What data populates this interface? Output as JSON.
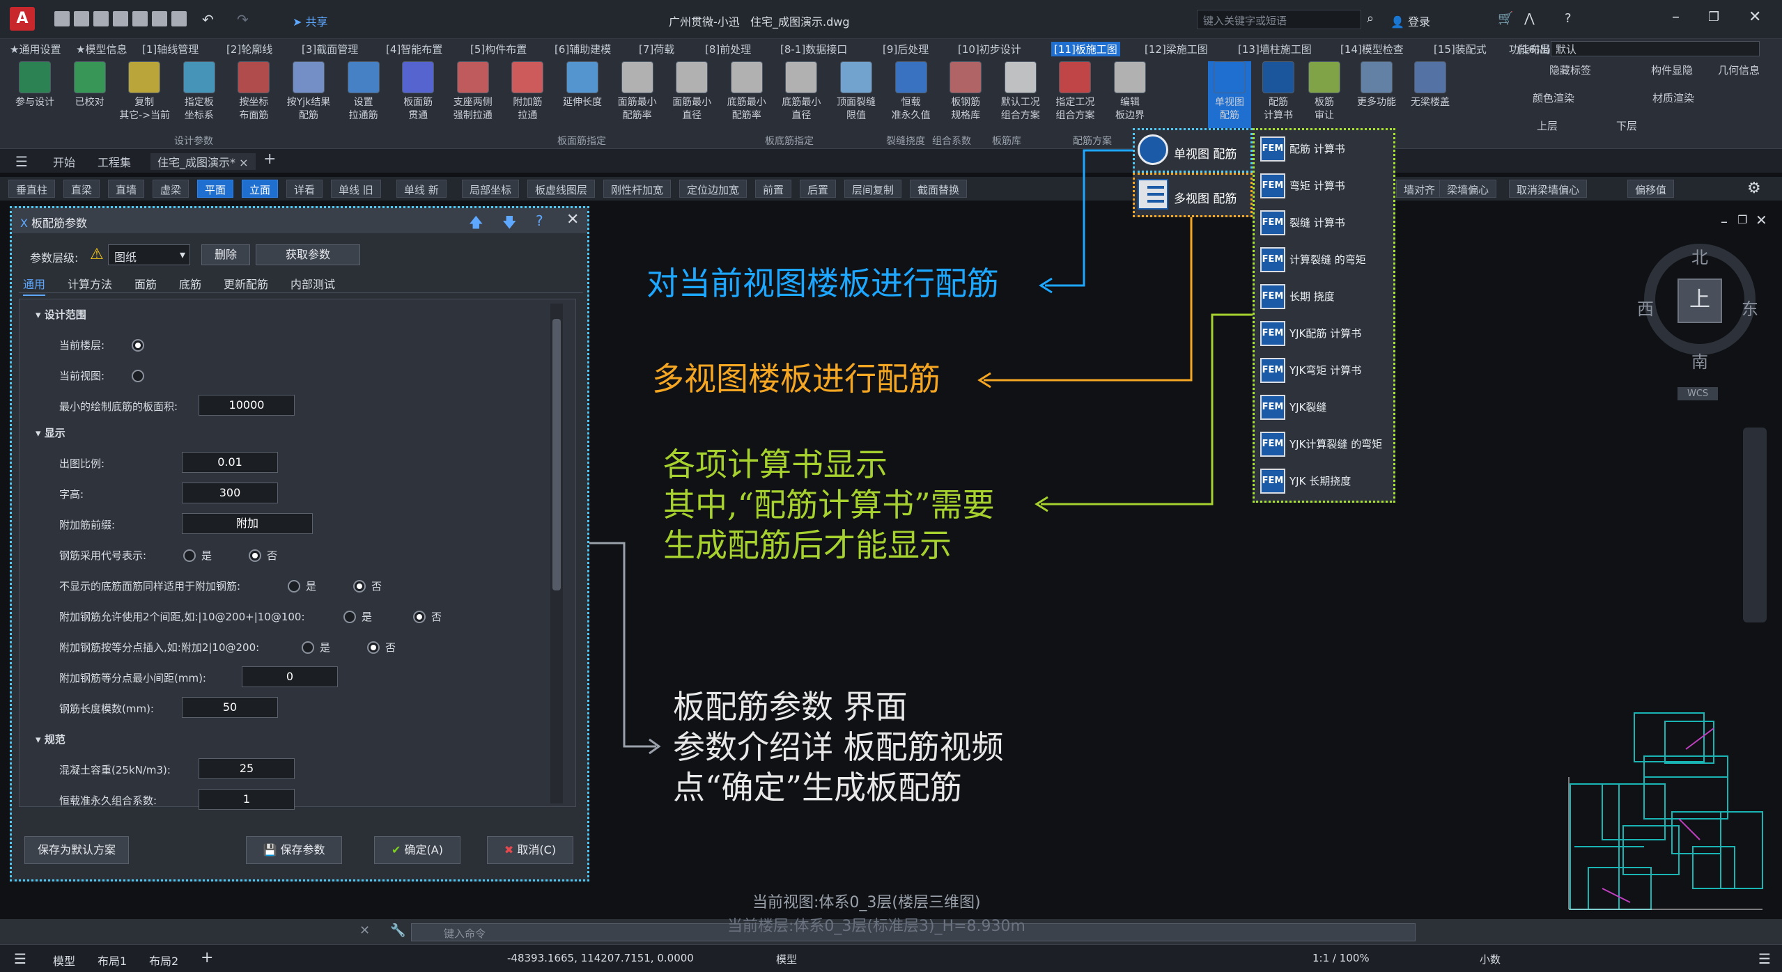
{
  "titlebar": {
    "share": "共享",
    "app_title": "广州贯微-小迅",
    "doc_title": "住宅_成图演示.dwg",
    "search_placeholder": "键入关键字或短语",
    "login": "登录"
  },
  "menu": {
    "items": [
      "★通用设置",
      "★模型信息",
      "[1]轴线管理",
      "[2]轮廓线",
      "[3]截面管理",
      "[4]智能布置",
      "[5]构件布置",
      "[6]辅助建模",
      "[7]荷载",
      "[8]前处理",
      "[8-1]数据接口",
      "[9]后处理",
      "[10]初步设计",
      "[11]板施工图",
      "[12]梁施工图",
      "[13]墙柱施工图",
      "[14]模型检查",
      "[15]装配式",
      "[16]出图"
    ],
    "layout_label": "功能布局:",
    "layout_value": "默认"
  },
  "ribbon": {
    "buttons": [
      "参与设计",
      "已校对",
      "复制\n其它->当前",
      "指定板\n坐标系",
      "按坐标\n布面筋",
      "按Yjk结果\n配筋",
      "设置\n拉通筋",
      "板面筋\n贯通",
      "支座两侧\n强制拉通",
      "附加筋\n拉通",
      "延伸长度",
      "面筋最小\n配筋率",
      "面筋最小\n直径",
      "底筋最小\n配筋率",
      "底筋最小\n直径",
      "顶面裂缝\n限值",
      "恒载\n准永久值",
      "板钢筋\n规格库",
      "默认工况\n组合方案",
      "指定工况\n组合方案",
      "编辑\n板边界",
      "单视图\n配筋",
      "配筋\n计算书",
      "板筋\n审让",
      "更多功能",
      "无梁楼盖"
    ],
    "groups": [
      "设计参数",
      "板面筋指定",
      "板底筋指定",
      "裂缝挠度",
      "组合系数",
      "板筋库",
      "配筋方案"
    ],
    "right_items": [
      "隐藏标签",
      "构件显隐",
      "几何信息",
      "颜色渲染",
      "材质渲染",
      "上层",
      "下层"
    ]
  },
  "doc_tabs": [
    "开始",
    "工程集",
    "住宅_成图演示*"
  ],
  "commands": [
    "垂直柱",
    "直梁",
    "直墙",
    "虚梁",
    "平面",
    "立面",
    "详看",
    "单线 旧",
    "单线 新",
    "局部坐标",
    "板虚线图层",
    "刚性杆加宽",
    "定位边加宽",
    "前置",
    "后置",
    "层间复制",
    "截面替换",
    "墙对齐",
    "梁墙偏心",
    "取消梁墙偏心",
    "偏移值"
  ],
  "popup": {
    "single": "单视图 配筋",
    "multi": "多视图 配筋"
  },
  "fem_menu": {
    "badge": "FEM",
    "items": [
      "配筋 计算书",
      "弯矩 计算书",
      "裂缝 计算书",
      "计算裂缝 的弯矩",
      "长期 挠度",
      "YJK配筋 计算书",
      "YJK弯矩 计算书",
      "YJK裂缝",
      "YJK计算裂缝 的弯矩",
      "YJK 长期挠度"
    ]
  },
  "dialog": {
    "title": "板配筋参数",
    "param_level_label": "参数层级:",
    "param_level_value": "图纸",
    "delete_btn": "删除",
    "get_params_btn": "获取参数",
    "tabs": [
      "通用",
      "计算方法",
      "面筋",
      "底筋",
      "更新配筋",
      "内部测试"
    ],
    "sections": {
      "range": "设计范围",
      "display": "显示",
      "spec": "规范"
    },
    "rows": {
      "current_floor": "当前楼层:",
      "current_view": "当前视图:",
      "min_area_label": "最小的绘制底筋的板面积:",
      "min_area_value": "10000",
      "scale_label": "出图比例:",
      "scale_value": "0.01",
      "text_height_label": "字高:",
      "text_height_value": "300",
      "prefix_label": "附加筋前缀:",
      "prefix_value": "附加",
      "code_label": "钢筋采用代号表示:",
      "hide_label": "不显示的底筋面筋同样适用于附加钢筋:",
      "two_spacing_label": "附加钢筋允许使用2个间距,如:|10@200+|10@100:",
      "equal_insert_label": "附加钢筋按等分点插入,如:附加2|10@200:",
      "min_spacing_label": "附加钢筋等分点最小间距(mm):",
      "min_spacing_value": "0",
      "modulus_label": "钢筋长度模数(mm):",
      "modulus_value": "50",
      "density_label": "混凝土容重(25kN/m3):",
      "density_value": "25",
      "combo_label": "恒载准永久组合系数:",
      "combo_value": "1",
      "yes": "是",
      "no": "否"
    },
    "save_default": "保存为默认方案",
    "save_params": "保存参数",
    "ok": "确定(A)",
    "cancel": "取消(C)"
  },
  "annotations": {
    "a1": "对当前视图楼板进行配筋",
    "a2": "多视图楼板进行配筋",
    "a3": [
      "各项计算书显示",
      "其中,“配筋计算书”需要",
      "生成配筋后才能显示"
    ],
    "a4": [
      "板配筋参数 界面",
      "参数介绍详 板配筋视频",
      "点“确定”生成板配筋"
    ]
  },
  "viewcube": {
    "north": "北",
    "south": "南",
    "east": "东",
    "west": "西",
    "top": "上",
    "wcs": "WCS"
  },
  "status": {
    "view_line": "当前视图:体系0_3层(楼层三维图)",
    "floor_line": "当前楼层:体系0_3层(标准层3)_H=8.930m",
    "cmd_placeholder": "键入命令",
    "layout_tabs": [
      "模型",
      "布局1",
      "布局2"
    ],
    "coords": "-48393.1665, 114207.7151, 0.0000",
    "model": "模型",
    "scale": "1:1 / 100%",
    "decimal": "小数"
  },
  "colors": {
    "accent_blue": "#1f6fd1",
    "ann_blue": "#1ea7ff",
    "ann_orange": "#f5a623",
    "ann_green": "#a6d12e",
    "ann_white": "#e8e8e8"
  }
}
